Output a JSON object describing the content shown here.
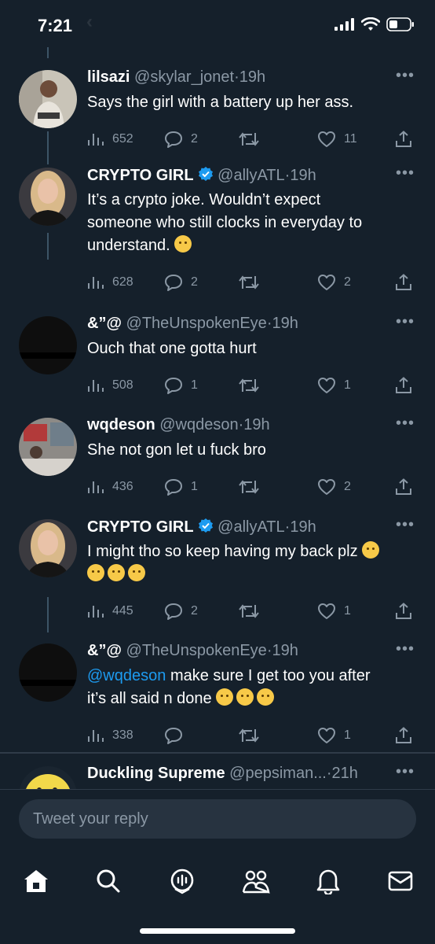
{
  "status_bar": {
    "time": "7:21"
  },
  "tweets": [
    {
      "name": "lilsazi",
      "handle": "@skylar_jonet",
      "time": "19h",
      "verified": false,
      "lines": [
        "Says the girl with a battery up her ass."
      ],
      "views": "652",
      "replies": "2",
      "retweets": "",
      "likes": "11",
      "avatar": "man-photo"
    },
    {
      "name": "CRYPTO GIRL",
      "handle": "@allyATL",
      "time": "19h",
      "verified": true,
      "lines": [
        "It’s a crypto joke. Wouldn’t expect",
        "someone who still clocks in everyday to",
        "understand. 🙃"
      ],
      "views": "628",
      "replies": "2",
      "retweets": "",
      "likes": "2",
      "avatar": "blonde-woman-photo"
    },
    {
      "name": "&”@",
      "handle": "@TheUnspokenEye",
      "time": "19h",
      "verified": false,
      "lines": [
        "Ouch that one gotta hurt"
      ],
      "views": "508",
      "replies": "1",
      "retweets": "",
      "likes": "1",
      "avatar": "dark-avatar"
    },
    {
      "name": "wqdeson",
      "handle": "@wqdeson",
      "time": "19h",
      "verified": false,
      "lines": [
        "She not gon let u fuck bro"
      ],
      "views": "436",
      "replies": "1",
      "retweets": "",
      "likes": "2",
      "avatar": "room-photo"
    },
    {
      "name": "CRYPTO GIRL",
      "handle": "@allyATL",
      "time": "19h",
      "verified": true,
      "lines": [
        "I might tho so keep having my back plz 🥰",
        "😭😂😉"
      ],
      "views": "445",
      "replies": "2",
      "retweets": "",
      "likes": "1",
      "avatar": "blonde-woman-photo"
    },
    {
      "name": "&”@",
      "handle": "@TheUnspokenEye",
      "time": "19h",
      "verified": false,
      "mention": "@wqdeson",
      "lines": [
        "make sure I get too you after",
        "it’s all said n done 🤣😆😆"
      ],
      "views": "338",
      "replies": "",
      "retweets": "",
      "likes": "1",
      "avatar": "dark-avatar"
    },
    {
      "name": "Duckling Supreme",
      "handle": "@pepsiman...",
      "time": "21h",
      "verified": false,
      "lines": [],
      "avatar": "yellow-duck-avatar"
    }
  ],
  "separator_dot": "·",
  "more_label": "•••",
  "reply_bar": {
    "placeholder": "Tweet your reply"
  },
  "tabbar": [
    "home",
    "search",
    "spaces",
    "communities",
    "notifications",
    "messages"
  ],
  "colors": {
    "background": "#15202b",
    "accent": "#1d9bf0",
    "muted": "#8b98a5"
  }
}
